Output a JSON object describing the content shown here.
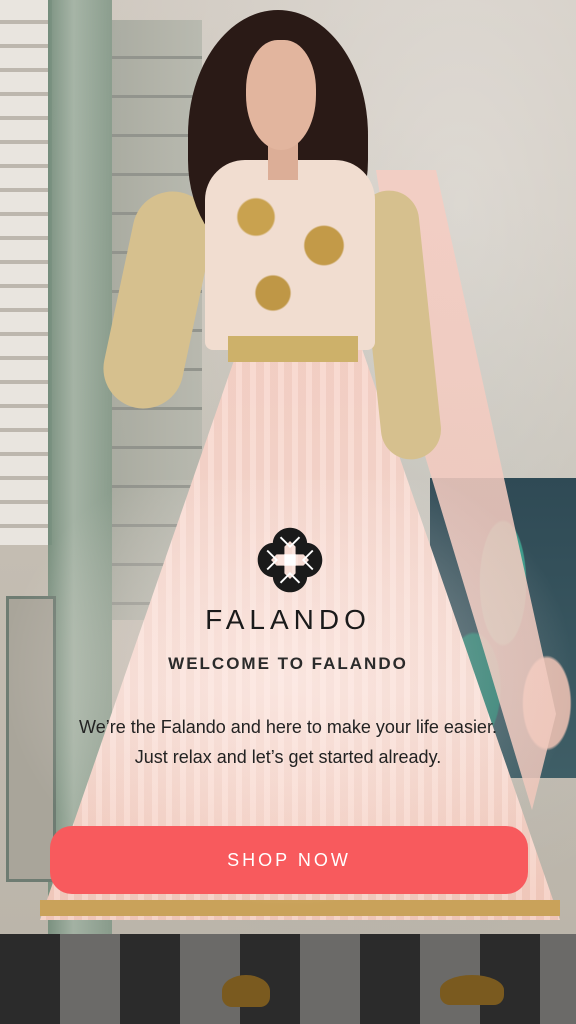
{
  "brand": {
    "name": "FALANDO",
    "logo_icon": "falando-logo-icon"
  },
  "welcome": {
    "title": "WELCOME TO FALANDO"
  },
  "description": {
    "line1": "We’re the Falando and here to make your life easier.",
    "line2": "Just relax and let’s get started already."
  },
  "cta": {
    "label": "SHOP NOW"
  },
  "colors": {
    "accent": "#f85a5d",
    "text": "#1a1a1a"
  }
}
